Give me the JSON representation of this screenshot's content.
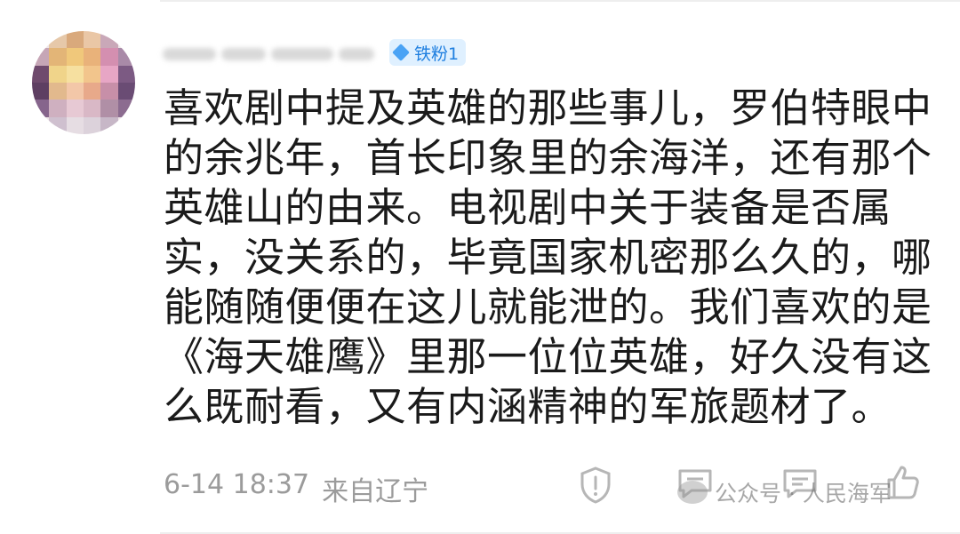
{
  "user": {
    "badge_label": "铁粉1"
  },
  "comment": {
    "text": "喜欢剧中提及英雄的那些事儿，罗伯特眼中的余兆年，首长印象里的余海洋，还有那个英雄山的由来。电视剧中关于装备是否属实，没关系的，毕竟国家机密那么久的，哪能随随便便在这儿就能泄的。我们喜欢的是《海天雄鹰》里那一位位英雄，好久没有这么既耐看，又有内涵精神的军旅题材了。"
  },
  "meta": {
    "timestamp": "6-14 18:37",
    "location": "来自辽宁"
  },
  "actions": {
    "icons": [
      "shield-icon",
      "comment-icon",
      "reply-icon",
      "like-icon"
    ]
  },
  "watermark": {
    "text": "公众号 · 人民海军"
  },
  "colors": {
    "badge_bg": "#dff0ff",
    "badge_text": "#1f7fe0",
    "meta_text": "#9b9b9b",
    "body_text": "#1a1a1a"
  }
}
